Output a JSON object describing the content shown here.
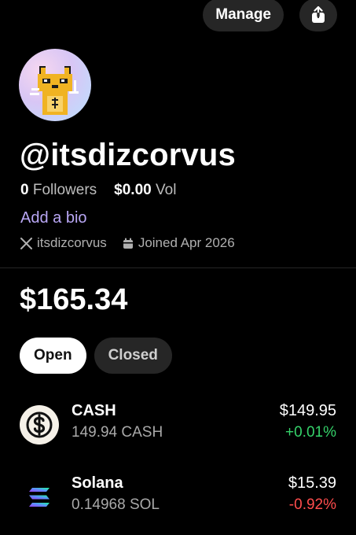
{
  "header": {
    "manage_label": "Manage"
  },
  "profile": {
    "username": "@itsdizcorvus",
    "followers_count": "0",
    "followers_label": "Followers",
    "volume_value": "$0.00",
    "volume_label": "Vol",
    "add_bio_label": "Add a bio",
    "x_handle": "itsdizcorvus",
    "joined_text": "Joined Apr 2026"
  },
  "portfolio": {
    "balance": "$165.34",
    "tabs": [
      {
        "label": "Open",
        "active": true
      },
      {
        "label": "Closed",
        "active": false
      }
    ],
    "assets": [
      {
        "name": "CASH",
        "amount": "149.94 CASH",
        "value": "$149.95",
        "change": "+0.01%",
        "direction": "up",
        "icon": "cash-dollar-icon"
      },
      {
        "name": "Solana",
        "amount": "0.14968 SOL",
        "value": "$15.39",
        "change": "-0.92%",
        "direction": "down",
        "icon": "solana-icon"
      }
    ]
  },
  "colors": {
    "accent_bio": "#b9a7f5",
    "positive": "#35d26a",
    "negative": "#ff4d4d",
    "pill_bg": "#262626"
  }
}
